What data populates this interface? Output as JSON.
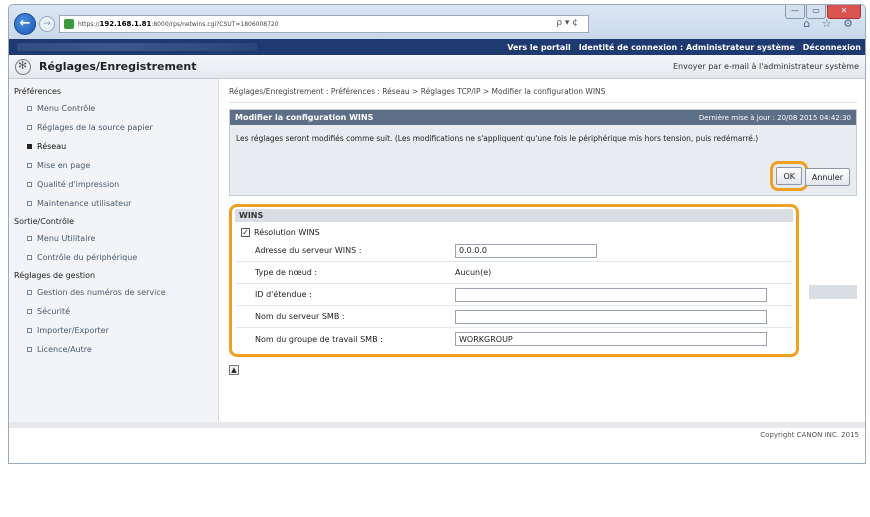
{
  "browser": {
    "url_prefix": "https://",
    "url_host": "192.168.1.81",
    "url_rest": ":8000/rps/netwins.cgi?CSUT=1806008720",
    "search_glyph": "ρ ▾ ¢",
    "toolbar_glyphs": "⌂ ☆ ⚙",
    "back_glyph": "←",
    "forward_glyph": "→",
    "minimize_glyph": "—",
    "maximize_glyph": "▭",
    "close_glyph": "✕"
  },
  "topbar": {
    "portal_link": "Vers le portail",
    "login_identity": "Identité de connexion : Administrateur système",
    "logout_link": "Déconnexion"
  },
  "header": {
    "title": "Réglages/Enregistrement",
    "email_link": "Envoyer par e-mail à l'administrateur système"
  },
  "sidebar": {
    "sections": [
      {
        "title": "Préférences",
        "items": [
          "Menu Contrôle",
          "Réglages de la source papier",
          "Réseau",
          "Mise en page",
          "Qualité d'impression",
          "Maintenance utilisateur"
        ]
      },
      {
        "title": "Sortie/Contrôle",
        "items": [
          "Menu Utilitaire",
          "Contrôle du périphérique"
        ]
      },
      {
        "title": "Réglages de gestion",
        "items": [
          "Gestion des numéros de service",
          "Sécurité",
          "Importer/Exporter",
          "Licence/Autre"
        ]
      }
    ],
    "active_item": "Réseau"
  },
  "main": {
    "breadcrumb": "Réglages/Enregistrement : Préférences : Réseau > Réglages TCP/IP > Modifier la configuration WINS",
    "card_title": "Modifier la configuration WINS",
    "last_update": "Dernière mise à jour : 20/08 2015 04:42:30",
    "notice": "Les réglages seront modifiés comme suit. (Les modifications ne s'appliquent qu'une fois le périphérique mis hors tension, puis redémarré.)",
    "ok_label": "OK",
    "cancel_label": "Annuler",
    "wins_section": "WINS",
    "wins_resolution_label": "Résolution WINS",
    "wins_resolution_checked": true,
    "fields": {
      "server_address_label": "Adresse du serveur WINS :",
      "server_address_value": "0.0.0.0",
      "node_type_label": "Type de nœud :",
      "node_type_value": "Aucun(e)",
      "scope_id_label": "ID d'étendue :",
      "scope_id_value": "",
      "smb_server_label": "Nom du serveur SMB :",
      "smb_server_value": "",
      "smb_group_label": "Nom du groupe de travail SMB :",
      "smb_group_value": "WORKGROUP"
    },
    "to_top_glyph": "▲"
  },
  "footer": {
    "copyright": "Copyright CANON INC. 2015"
  },
  "colors": {
    "topbar_bg": "#1f3a70",
    "highlight_outline": "#f0a020",
    "card_header_bg": "#5c6f86"
  }
}
